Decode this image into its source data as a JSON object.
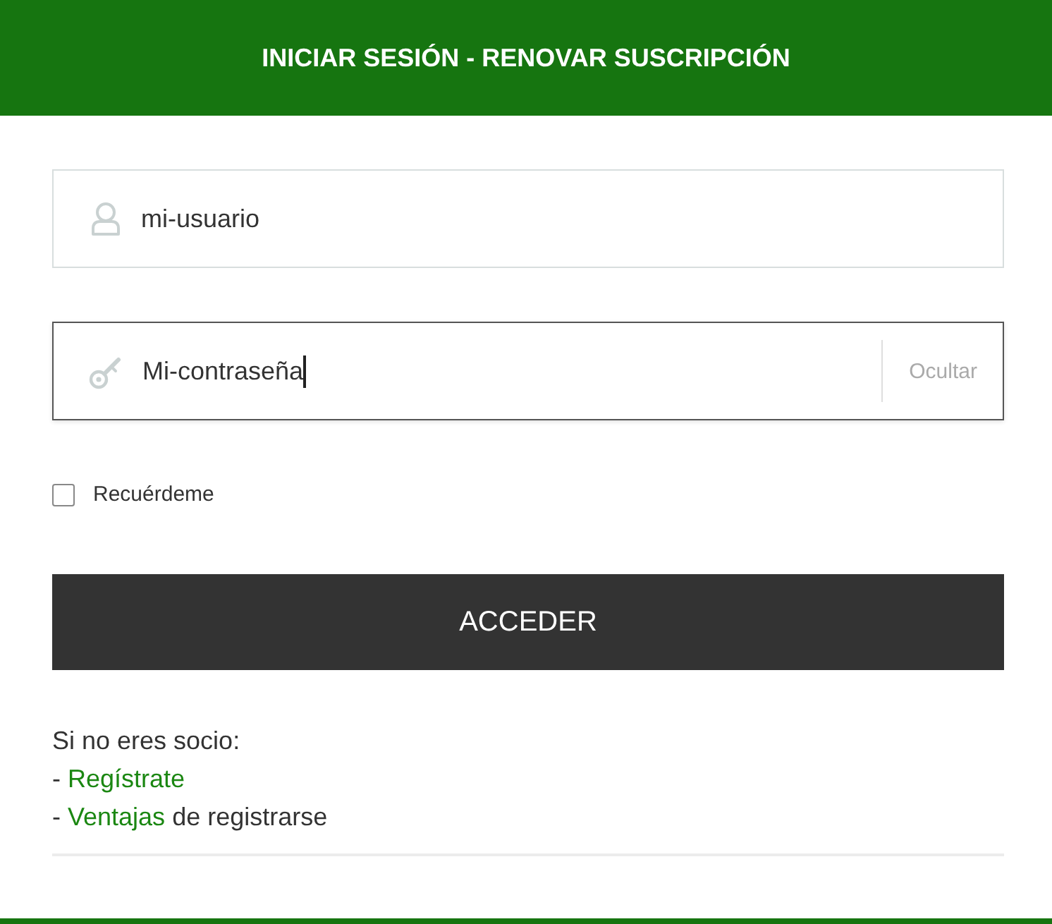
{
  "header": {
    "title": "INICIAR SESIÓN - RENOVAR SUSCRIPCIÓN"
  },
  "form": {
    "fields": [
      {
        "kind": "username",
        "value": "mi-usuario",
        "focused": false
      },
      {
        "kind": "password",
        "value": "Mi-contraseña",
        "focused": true,
        "toggle_label": "Ocultar"
      }
    ],
    "remember": {
      "label": "Recuérdeme",
      "checked": false
    },
    "submit": {
      "label": "ACCEDER"
    }
  },
  "register": {
    "intro": "Si no eres socio:",
    "lines": [
      {
        "prefix": "-",
        "link": "Regístrate"
      },
      {
        "prefix": "-",
        "link": "Ventajas",
        "rest": "de registrarse"
      }
    ]
  }
}
